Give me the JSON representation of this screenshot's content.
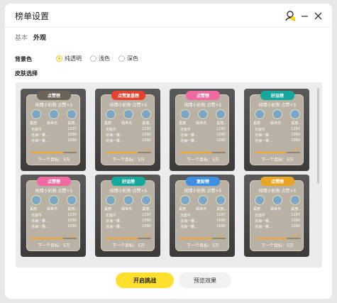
{
  "window": {
    "title": "榜单设置"
  },
  "tabs": [
    {
      "label": "基本"
    },
    {
      "label": "外观"
    }
  ],
  "background": {
    "label": "背景色",
    "options": [
      {
        "label": "纯透明"
      },
      {
        "label": "浅色"
      },
      {
        "label": "深色"
      }
    ],
    "selected": "纯透明"
  },
  "skins_label": "皮肤选择",
  "skins": [
    {
      "badge": "点赞榜",
      "badge_color": "#6b6458",
      "title": "纯情小奶狗 点赞+5",
      "names": [
        "奚丽",
        "嫣世杰",
        "奚丽..."
      ],
      "rows": [
        {
          "name": "无敌牛",
          "value": "1297"
        },
        {
          "name": "沧海一粟...",
          "value": "1090"
        },
        {
          "name": "沧海一粟...",
          "value": "1090"
        }
      ],
      "progress": 0.7,
      "progress_text": "3.7万",
      "goal": "下一个目标：5万"
    },
    {
      "badge": "点赞复盘榜",
      "badge_color": "#e4432d",
      "title": "纯情小奶狗 点赞+5",
      "names": [
        "奚丽",
        "嫣世杰",
        "奚丽..."
      ],
      "rows": [
        {
          "name": "无敌牛",
          "value": "1297"
        },
        {
          "name": "沧海一粟...",
          "value": "1090"
        },
        {
          "name": "沧海一粟...",
          "value": "1090"
        }
      ],
      "progress": 0.7,
      "progress_text": "3.7万",
      "goal": "下一个目标：5万"
    },
    {
      "badge": "点赞榜",
      "badge_color": "#ef6aa0",
      "title": "纯情小奶狗 点赞+5",
      "names": [
        "奚丽",
        "嫣世杰",
        "奚丽..."
      ],
      "rows": [
        {
          "name": "无敌牛",
          "value": "1297"
        },
        {
          "name": "沧海一粟...",
          "value": "1090"
        },
        {
          "name": "沧海一粟...",
          "value": "1090"
        }
      ],
      "progress": 0.7,
      "progress_text": "3.7万",
      "goal": "下一个目标：5万"
    },
    {
      "badge": "好运榜",
      "badge_color": "#16a79d",
      "title": "纯情小奶狗 点赞+5",
      "names": [
        "奚丽",
        "嫣世杰",
        "奚丽..."
      ],
      "rows": [
        {
          "name": "无敌牛",
          "value": "1297"
        },
        {
          "name": "沧海一粟...",
          "value": "1090"
        },
        {
          "name": "沧海一粟...",
          "value": "1090"
        }
      ],
      "progress": 0.7,
      "progress_text": "3.7万",
      "goal": "下一个目标：5万"
    },
    {
      "badge": "点赞榜",
      "badge_color": "#ef6aa0",
      "title": "纯情小奶狗 点赞+5",
      "names": [
        "奚丽",
        "嫣世杰",
        "奚丽..."
      ],
      "rows": [
        {
          "name": "无敌牛",
          "value": "1297"
        },
        {
          "name": "沧海一粟...",
          "value": "1090"
        },
        {
          "name": "沧海一粟...",
          "value": "1090"
        }
      ],
      "progress": 0.7,
      "progress_text": "3.7万",
      "goal": "下一个目标：5万"
    },
    {
      "badge": "好运榜",
      "badge_color": "#16a79d",
      "title": "纯情小奶狗 点赞+5",
      "names": [
        "奚丽",
        "嫣世杰",
        "奚丽..."
      ],
      "rows": [
        {
          "name": "无敌牛",
          "value": "1297"
        },
        {
          "name": "沧海一粟...",
          "value": "1090"
        },
        {
          "name": "沧海一粟...",
          "value": "1090"
        }
      ],
      "progress": 0.7,
      "progress_text": "3.7万",
      "goal": "下一个目标：5万"
    },
    {
      "badge": "复财榜",
      "badge_color": "#3f8fe0",
      "title": "纯情小奶狗 点赞+5",
      "names": [
        "奚丽",
        "嫣世杰",
        "奚丽..."
      ],
      "rows": [
        {
          "name": "无敌牛",
          "value": "1297"
        },
        {
          "name": "沧海一粟...",
          "value": "1090"
        },
        {
          "name": "沧海一粟...",
          "value": "1090"
        }
      ],
      "progress": 0.7,
      "progress_text": "3.7万",
      "goal": "下一个目标：5万"
    },
    {
      "badge": "点赞榜",
      "badge_color": "#e9a526",
      "title": "纯情小奶狗 点赞+5",
      "names": [
        "奚丽",
        "嫣世杰",
        "奚丽..."
      ],
      "rows": [
        {
          "name": "无敌牛",
          "value": "1297"
        },
        {
          "name": "沧海一粟...",
          "value": "1090"
        },
        {
          "name": "沧海一粟...",
          "value": "1090"
        }
      ],
      "progress": 0.7,
      "progress_text": "3.7万",
      "goal": "下一个目标：5万"
    }
  ],
  "actions": {
    "start": "开启挑战",
    "preview": "预览效果"
  },
  "colors": {
    "accent": "#ffe02e",
    "radio_on": "#f5c400"
  },
  "icons": {
    "user_badge": "user-badge-icon",
    "minimize": "minimize-icon",
    "close": "close-icon"
  }
}
